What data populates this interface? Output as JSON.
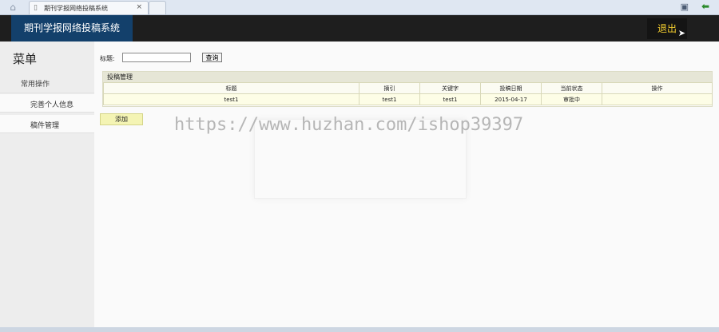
{
  "browser": {
    "tab_title": "期刊学报网络投稿系统",
    "tab_close": "×"
  },
  "header": {
    "brand": "期刊学报网络投稿系统",
    "logout": "退出"
  },
  "sidebar": {
    "title": "菜单",
    "group": "常用操作",
    "items": [
      {
        "label": "完善个人信息"
      },
      {
        "label": "稿件管理"
      }
    ]
  },
  "search": {
    "label": "标题:",
    "value": "",
    "button": "查询"
  },
  "panel": {
    "title": "投稿管理",
    "columns": [
      "标题",
      "摘引",
      "关键字",
      "投稿日期",
      "当前状态",
      "操作"
    ],
    "rows": [
      [
        "test1",
        "test1",
        "test1",
        "2015-04-17",
        "审批中",
        ""
      ]
    ]
  },
  "actions": {
    "add": "添加"
  },
  "watermark": "https://www.huzhan.com/ishop39397"
}
